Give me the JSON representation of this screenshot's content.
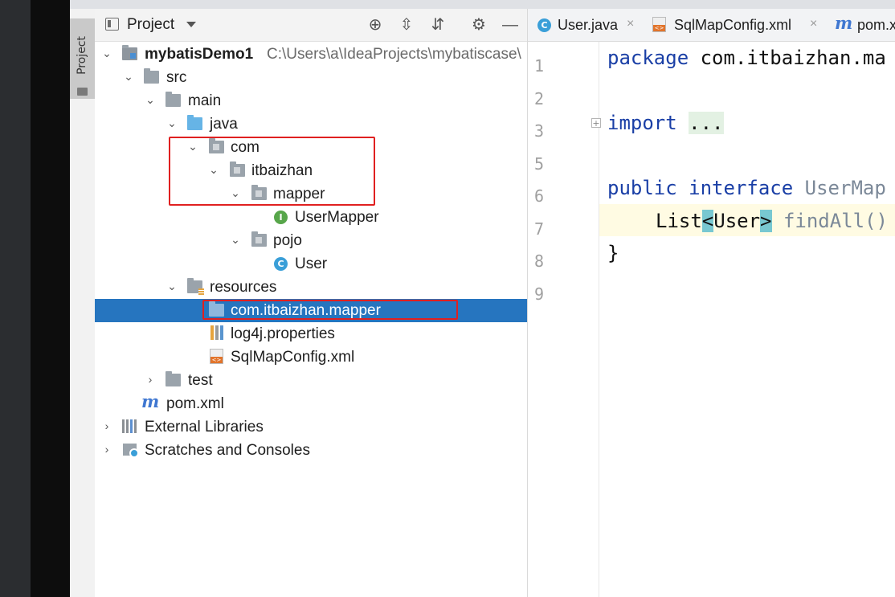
{
  "tool_window": {
    "side_tab_label": "Project",
    "title": "Project",
    "actions": [
      {
        "name": "locate-icon",
        "glyph": "⊕"
      },
      {
        "name": "expand-all-icon",
        "glyph": "⇳"
      },
      {
        "name": "collapse-all-icon",
        "glyph": "⇵"
      },
      {
        "name": "gear-icon",
        "glyph": "⚙"
      },
      {
        "name": "minimize-icon",
        "glyph": "—"
      }
    ]
  },
  "tree": {
    "root": {
      "label": "mybatisDemo1",
      "path": "C:\\Users\\a\\IdeaProjects\\mybatiscase\\"
    },
    "src": "src",
    "main": "main",
    "java": "java",
    "com": "com",
    "itbaizhan": "itbaizhan",
    "mapper": "mapper",
    "user_mapper": "UserMapper",
    "pojo": "pojo",
    "user": "User",
    "resources": "resources",
    "resources_mapper": "com.itbaizhan.mapper",
    "log4j": "log4j.properties",
    "sqlmapconfig": "SqlMapConfig.xml",
    "test": "test",
    "pom": "pom.xml",
    "external_libraries": "External Libraries",
    "scratches": "Scratches and Consoles",
    "interface_glyph": "I",
    "class_glyph": "C",
    "maven_glyph": "m"
  },
  "editor": {
    "tabs": [
      {
        "label": "User.java",
        "close": "×"
      },
      {
        "label": "SqlMapConfig.xml",
        "close": "×"
      },
      {
        "label": "pom.x"
      }
    ],
    "fold_glyph": "+",
    "lines": [
      "1",
      "2",
      "3",
      "5",
      "6",
      "7",
      "8",
      "9"
    ],
    "code": {
      "l1_kw": "package",
      "l1_rest": " com.itbaizhan.ma",
      "l3_kw": "import",
      "l3_rest": "...",
      "l6_kw1": "public",
      "l6_kw2": "interface",
      "l6_rest": " UserMap",
      "l7_a": "List",
      "l7_lt": "<",
      "l7_type": "User",
      "l7_gt": ">",
      "l7_method": " findAll()",
      "l8": "}"
    }
  },
  "colors": {
    "selection": "#2675bf",
    "highlight_box": "#e02020",
    "keyword": "#1a3fa6"
  }
}
